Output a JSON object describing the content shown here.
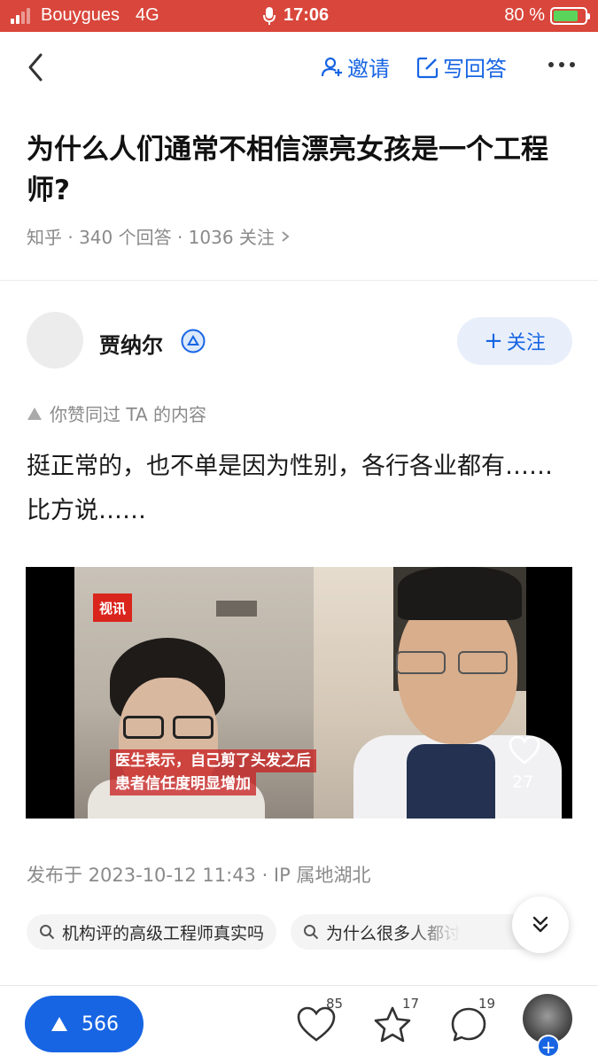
{
  "status_bar": {
    "carrier": "Bouygues",
    "network": "4G",
    "time": "17:06",
    "battery": "80 %",
    "battery_level": 0.8,
    "background_color": "#d9463b"
  },
  "nav": {
    "invite_label": "邀请",
    "write_answer_label": "写回答"
  },
  "question": {
    "title": "为什么人们通常不相信漂亮女孩是一个工程师?",
    "meta": "知乎 · 340 个回答 · 1036 关注"
  },
  "author": {
    "name": "贾纳尔",
    "follow_label": "关注"
  },
  "liked_note": "你赞同过 TA 的内容",
  "answer": {
    "text": "挺正常的，也不单是因为性别，各行各业都有……比方说……"
  },
  "video": {
    "logo_text": "视讯",
    "caption_line1": "医生表示，自己剪了头发之后",
    "caption_line2": "患者信任度明显增加",
    "like_count": "27"
  },
  "publish_info": "发布于 2023-10-12 11:43 · IP 属地湖北",
  "related_searches": [
    "机构评的高级工程师真实吗",
    "为什么很多人都讨"
  ],
  "bottom_bar": {
    "vote_count": "566",
    "like_count": "85",
    "favorite_count": "17",
    "comment_count": "19"
  },
  "colors": {
    "accent": "#1765e3",
    "follow_bg": "#e8effb"
  }
}
